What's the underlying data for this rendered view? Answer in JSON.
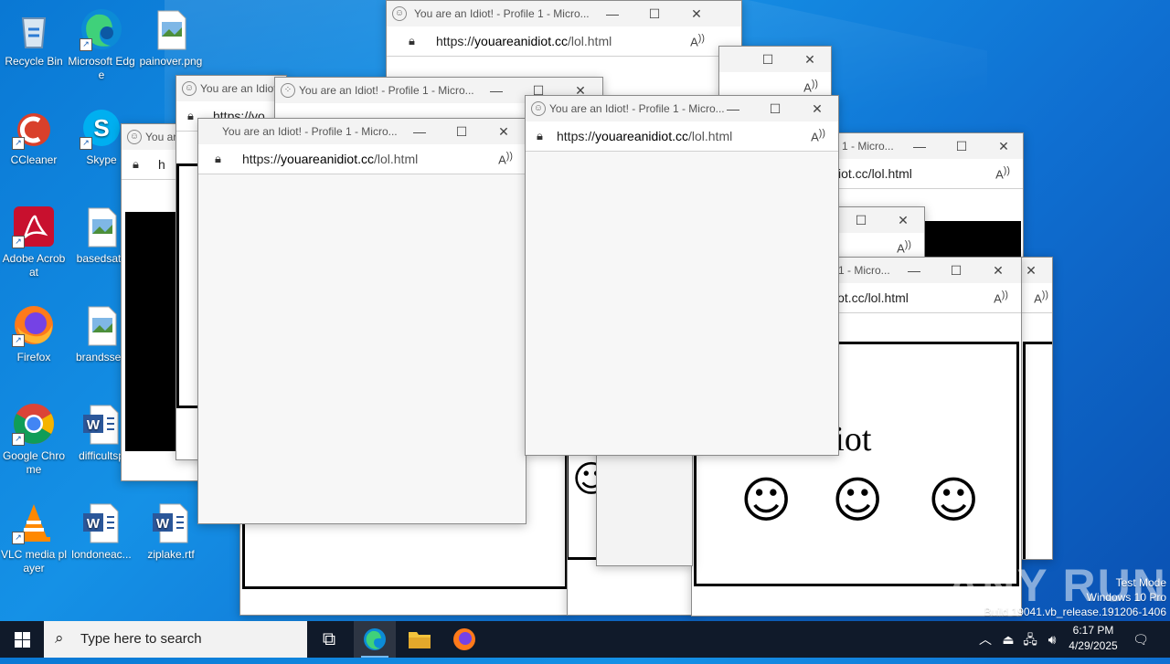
{
  "desktop": {
    "icons": [
      {
        "label": "Recycle Bin",
        "icon": "recycle-bin-icon"
      },
      {
        "label": "Microsoft Edge",
        "icon": "edge-icon"
      },
      {
        "label": "painover.png",
        "icon": "image-file-icon"
      },
      {
        "label": "CCleaner",
        "icon": "ccleaner-icon"
      },
      {
        "label": "Skype",
        "icon": "skype-icon"
      },
      {
        "label": "Adobe Acrobat",
        "icon": "acrobat-icon"
      },
      {
        "label": "basedsat.j",
        "icon": "image-file-icon"
      },
      {
        "label": "Firefox",
        "icon": "firefox-icon"
      },
      {
        "label": "brandssep",
        "icon": "image-file-icon"
      },
      {
        "label": "Google Chrome",
        "icon": "chrome-icon"
      },
      {
        "label": "difficultsp",
        "icon": "word-file-icon"
      },
      {
        "label": "VLC media player",
        "icon": "vlc-icon"
      },
      {
        "label": "londoneac...",
        "icon": "word-file-icon"
      },
      {
        "label": "ziplake.rtf",
        "icon": "word-file-icon"
      }
    ]
  },
  "browser": {
    "title": "You are an Idiot! - Profile 1 - Micro...",
    "title_short": "You are an Idiot!",
    "title_tail": "1 - Micro...",
    "title_stub": "You ar",
    "url": "https://youareanidiot.cc/lol.html",
    "url_host": "youareanidiot.cc",
    "url_scheme": "https://",
    "url_path": "/lol.html",
    "url_tail": "iot.cc/lol.html",
    "url_stub": "h",
    "url_stub2": "https://yo",
    "page_text": "You are an idiot",
    "page_text_partial": "e an idiot",
    "minimize_icon": "minimize-icon",
    "maximize_icon": "maximize-icon",
    "close_icon": "close-icon",
    "lock_icon": "lock-icon",
    "read_aloud_icon": "read-aloud-icon"
  },
  "taskbar": {
    "search_placeholder": "Type here to search",
    "time": "6:17 PM",
    "date": "4/29/2025",
    "apps": [
      "task-view-icon",
      "edge-icon",
      "file-explorer-icon",
      "firefox-icon"
    ]
  },
  "watermark": {
    "mode": "Test Mode",
    "edition": "Windows 10 Pro",
    "build": "Build 19041.vb_release.191206-1406",
    "brand": "ANY RUN"
  }
}
